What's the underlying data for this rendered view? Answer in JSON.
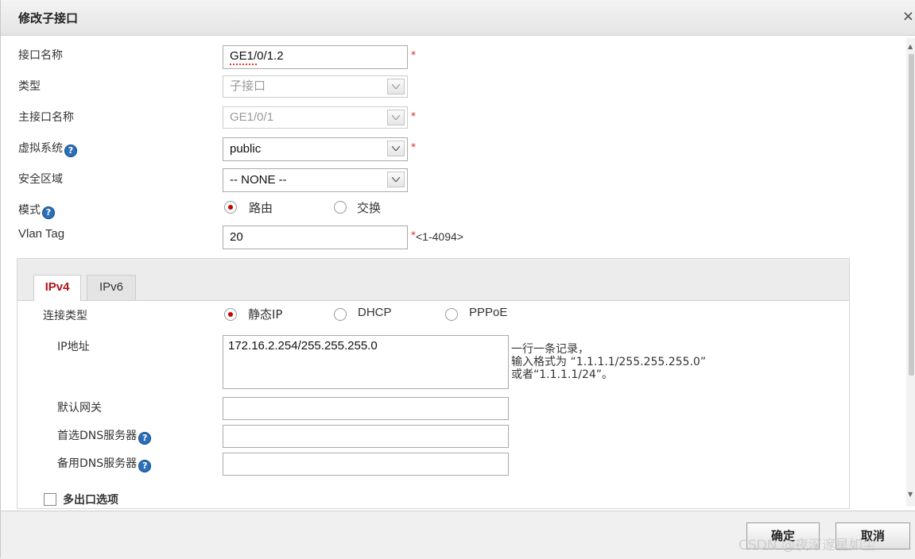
{
  "dialog": {
    "title": "修改子接口",
    "close_glyph": "×"
  },
  "form": {
    "interface_name": {
      "label": "接口名称",
      "value": "GE1/0/1.2"
    },
    "type": {
      "label": "类型",
      "value": "子接口"
    },
    "main_interface": {
      "label": "主接口名称",
      "value": "GE1/0/1"
    },
    "virtual_system": {
      "label": "虚拟系统",
      "value": "public"
    },
    "security_zone": {
      "label": "安全区域",
      "value": "-- NONE --"
    },
    "mode": {
      "label": "模式",
      "options": [
        "路由",
        "交换"
      ],
      "selected": "路由"
    },
    "vlan_tag": {
      "label": "Vlan Tag",
      "value": "20",
      "range": "<1-4094>"
    }
  },
  "required_mark": "*",
  "help_glyph": "?",
  "tabs": [
    {
      "label": "IPv4",
      "active": true
    },
    {
      "label": "IPv6",
      "active": false
    }
  ],
  "ipv4": {
    "connection_type": {
      "label": "连接类型",
      "options": [
        "静态IP",
        "DHCP",
        "PPPoE"
      ],
      "selected": "静态IP"
    },
    "ip_address": {
      "label": "IP地址",
      "value": "172.16.2.254/255.255.255.0"
    },
    "hint": {
      "line1": "一行一条记录，",
      "line2": "输入格式为 “1.1.1.1/255.255.255.0”",
      "line3": "或者“1.1.1.1/24”。"
    },
    "default_gateway": {
      "label": "默认网关",
      "value": ""
    },
    "primary_dns": {
      "label": "首选DNS服务器",
      "value": ""
    },
    "secondary_dns": {
      "label": "备用DNS服务器",
      "value": ""
    },
    "multi_exit": {
      "label": "多出口选项",
      "checked": false
    }
  },
  "footer": {
    "ok_label": "确定",
    "cancel_label": "取消"
  },
  "watermark": "CSDN @夜深邃星如尘",
  "colors": {
    "accent": "#b0131a",
    "required": "#dd2222",
    "help": "#2b6fb8"
  },
  "icons": [
    "close-icon",
    "help-icon",
    "chevron-down-icon",
    "scroll-up-icon",
    "scroll-down-icon"
  ]
}
